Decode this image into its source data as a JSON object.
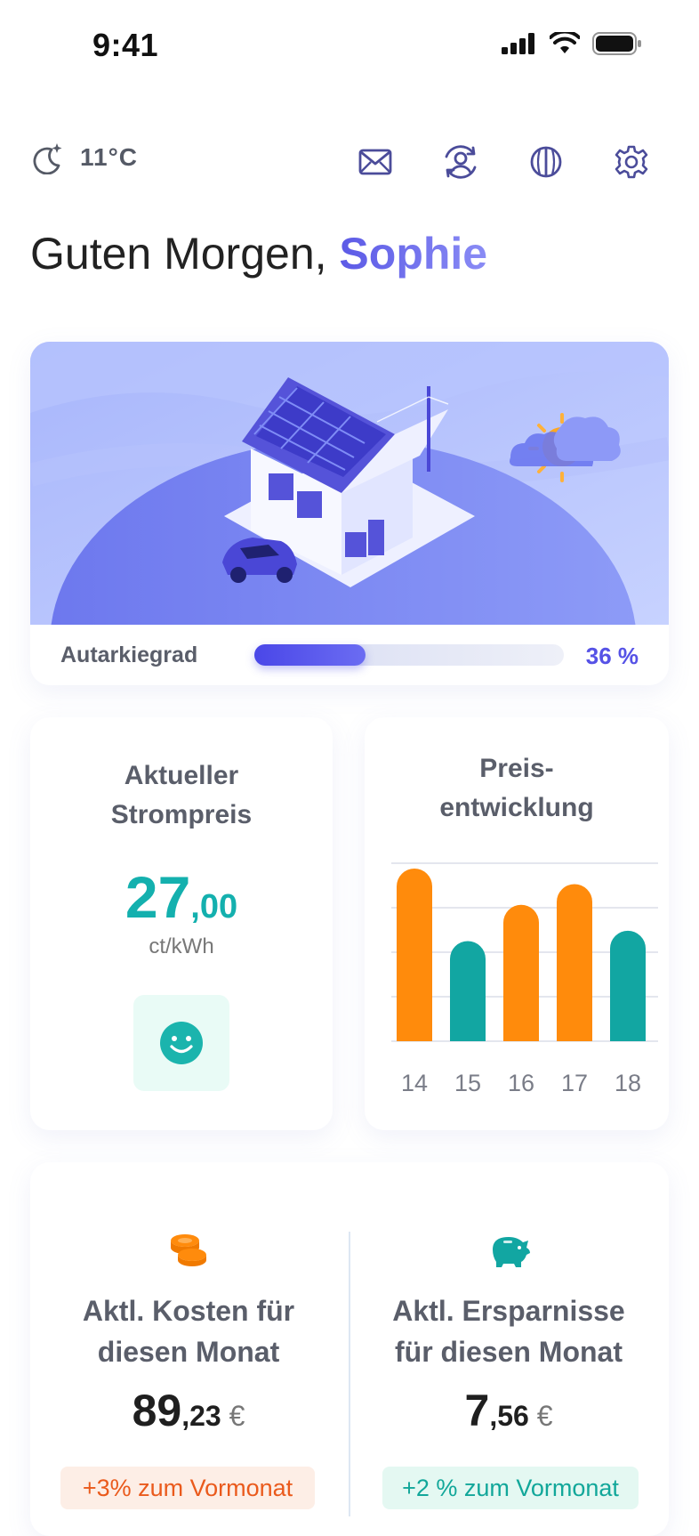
{
  "status_bar": {
    "time": "9:41"
  },
  "top_bar": {
    "weather_icon": "moon-stars-icon",
    "temperature": "11°C",
    "icons": [
      "mail-icon",
      "user-sync-icon",
      "theme-toggle-icon",
      "gear-icon"
    ]
  },
  "greeting": {
    "prefix": "Guten Morgen, ",
    "name": "Sophie"
  },
  "hero": {
    "autarky_label": "Autarkiegrad",
    "autarky_percent": 36,
    "autarky_value": "36 %"
  },
  "price_card": {
    "title_line1": "Aktueller",
    "title_line2": "Strompreis",
    "value_main": "27",
    "value_decimal": ",00",
    "unit": "ct/kWh",
    "mood_icon": "smiley-icon"
  },
  "trend_card": {
    "title_line1": "Preis-",
    "title_line2": "entwicklung"
  },
  "chart_data": {
    "type": "bar",
    "categories": [
      "14",
      "15",
      "16",
      "17",
      "18"
    ],
    "values": [
      100,
      58,
      79,
      91,
      64
    ],
    "colors": [
      "#ff8b0c",
      "#12a6a2",
      "#ff8b0c",
      "#ff8b0c",
      "#12a6a2"
    ],
    "title": "",
    "xlabel": "",
    "ylabel": "",
    "grid": true
  },
  "costs": {
    "cost_icon": "coins-icon",
    "cost_title_line1": "Aktl. Kosten für",
    "cost_title_line2": "diesen Monat",
    "cost_main": "89",
    "cost_decimal": ",23",
    "currency": " €",
    "cost_badge": "+3% zum Vormonat",
    "savings_icon": "piggy-bank-icon",
    "savings_title_line1": "Aktl. Ersparnisse",
    "savings_title_line2": "für diesen Monat",
    "savings_main": "7",
    "savings_decimal": ",56",
    "savings_badge": "+2 % zum Vormonat"
  },
  "colors": {
    "accent": "#5652e6",
    "teal": "#12a6a2",
    "orange": "#ff8b0c",
    "cost_badge_text": "#ea5a1c",
    "savings_badge_text": "#12a79a"
  }
}
